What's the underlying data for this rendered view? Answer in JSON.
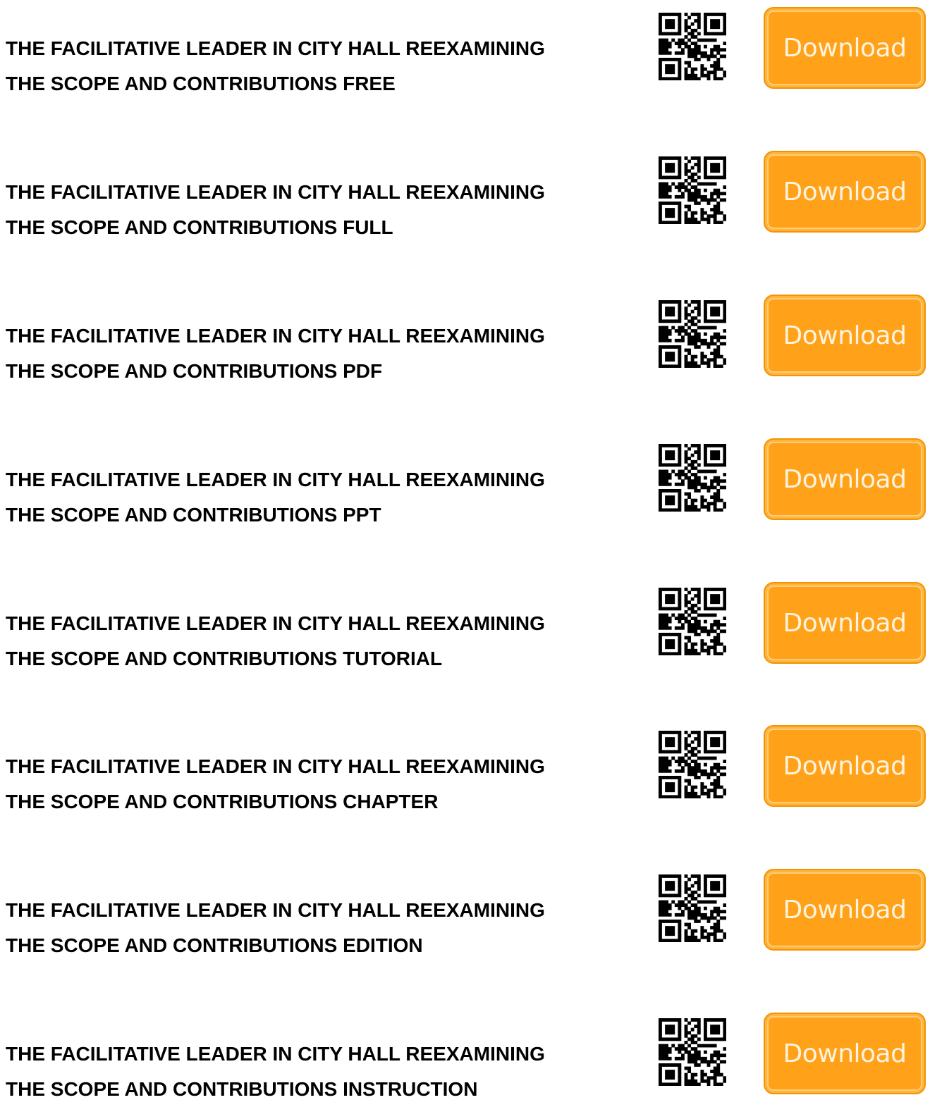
{
  "colors": {
    "button_fill": "#ffa21a",
    "button_text": "#fff3dd",
    "title_text": "#000000"
  },
  "qr_icon": "qr-code-icon",
  "rows": [
    {
      "line1": "THE FACILITATIVE LEADER IN CITY HALL REEXAMINING",
      "line2": "THE SCOPE AND CONTRIBUTIONS FREE",
      "button": "Download"
    },
    {
      "line1": "THE FACILITATIVE LEADER IN CITY HALL REEXAMINING",
      "line2": "THE SCOPE AND CONTRIBUTIONS FULL",
      "button": "Download"
    },
    {
      "line1": "THE FACILITATIVE LEADER IN CITY HALL REEXAMINING",
      "line2": "THE SCOPE AND CONTRIBUTIONS PDF",
      "button": "Download"
    },
    {
      "line1": "THE FACILITATIVE LEADER IN CITY HALL REEXAMINING",
      "line2": "THE SCOPE AND CONTRIBUTIONS PPT",
      "button": "Download"
    },
    {
      "line1": "THE FACILITATIVE LEADER IN CITY HALL REEXAMINING",
      "line2": "THE SCOPE AND CONTRIBUTIONS TUTORIAL",
      "button": "Download"
    },
    {
      "line1": "THE FACILITATIVE LEADER IN CITY HALL REEXAMINING",
      "line2": "THE SCOPE AND CONTRIBUTIONS CHAPTER",
      "button": "Download"
    },
    {
      "line1": "THE FACILITATIVE LEADER IN CITY HALL REEXAMINING",
      "line2": "THE SCOPE AND CONTRIBUTIONS EDITION",
      "button": "Download"
    },
    {
      "line1": "THE FACILITATIVE LEADER IN CITY HALL REEXAMINING",
      "line2": "THE SCOPE AND CONTRIBUTIONS INSTRUCTION",
      "button": "Download"
    }
  ]
}
